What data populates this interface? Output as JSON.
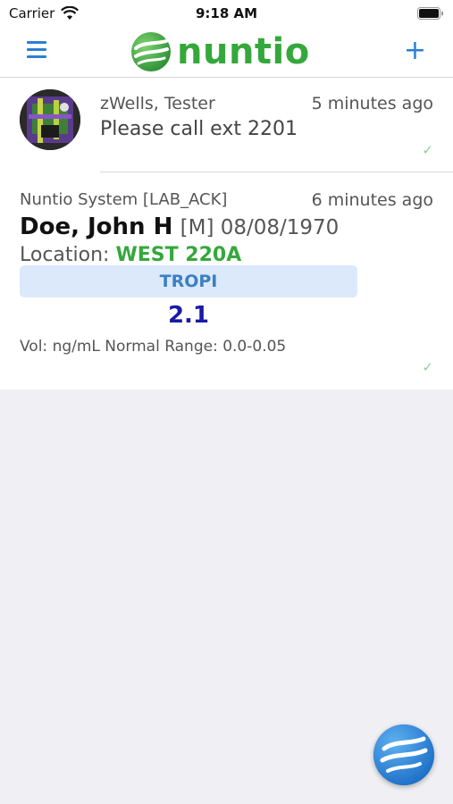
{
  "status_bar": {
    "carrier": "Carrier",
    "time": "9:18 AM"
  },
  "nav": {
    "logo_text": "nuntio",
    "menu_icon": "hamburger-menu-icon",
    "add_icon": "plus-icon",
    "brand_color": "#35a83c",
    "accent_color": "#2a7fd4"
  },
  "messages": [
    {
      "sender": "zWells, Tester",
      "time": "5 minutes ago",
      "body": "Please call ext 2201",
      "status_icon": "check-icon"
    },
    {
      "sender": "Nuntio System [LAB_ACK]",
      "time": "6 minutes ago",
      "patient_name": "Doe, John H",
      "patient_meta": "[M] 08/08/1970",
      "location_label": "Location:",
      "location_value": "WEST 220A",
      "test_name": "TROPI",
      "result_value": "2.1",
      "units_line": "Vol: ng/mL  Normal Range: 0.0-0.05",
      "status_icon": "check-icon"
    }
  ],
  "fab": {
    "icon": "globe-compose-icon"
  }
}
